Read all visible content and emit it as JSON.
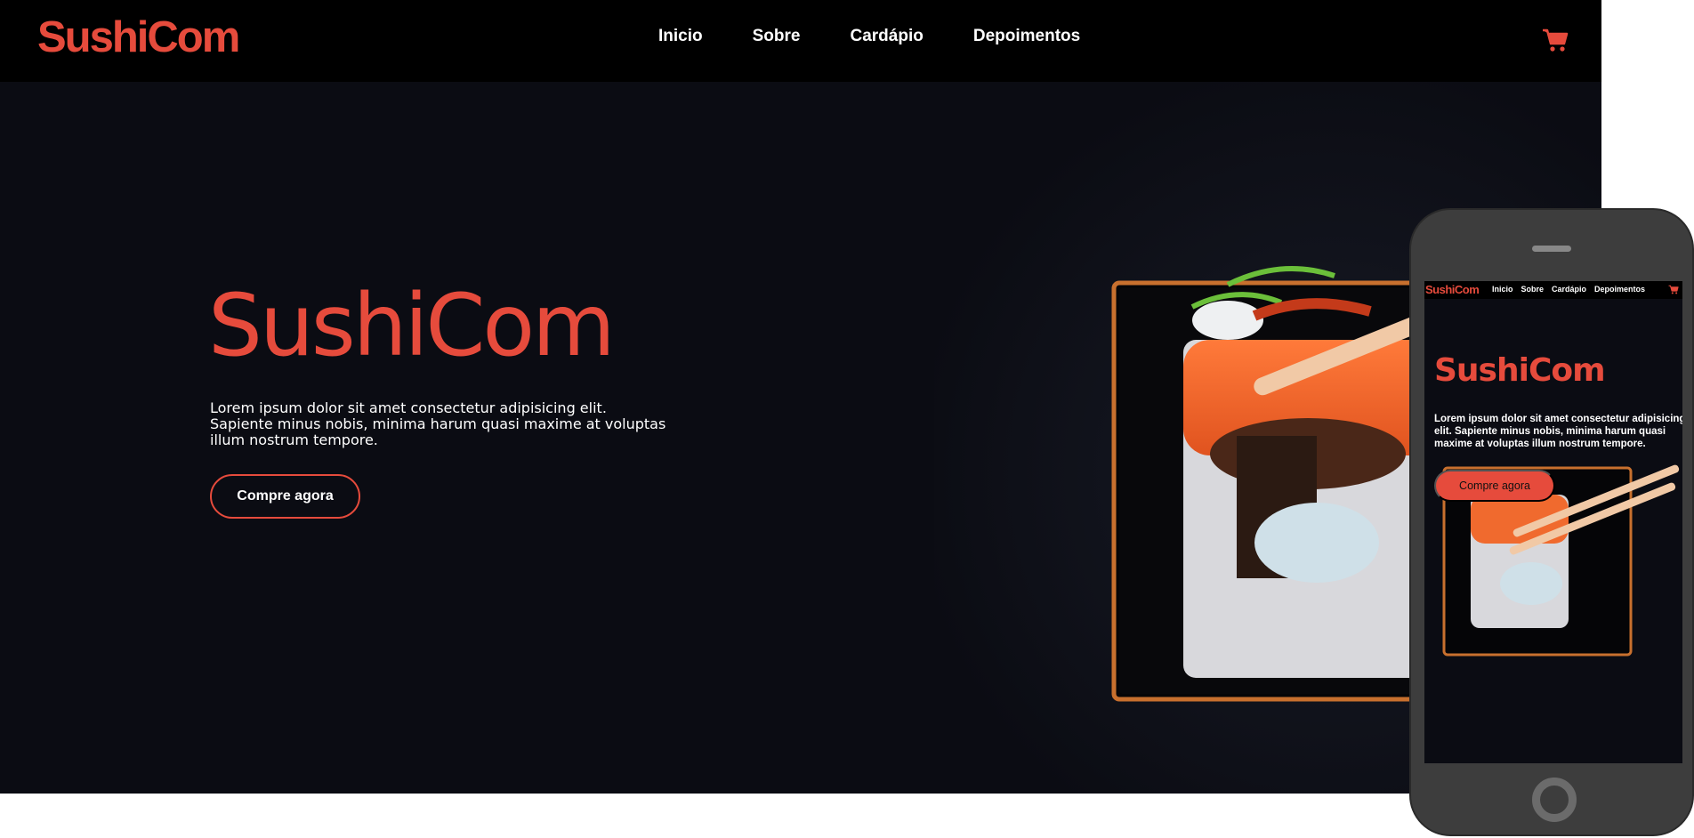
{
  "brand": {
    "logo_text": "SushiCom",
    "accent": "#e64b3c"
  },
  "nav": {
    "items": [
      {
        "label": "Inicio"
      },
      {
        "label": "Sobre"
      },
      {
        "label": "Cardápio"
      },
      {
        "label": "Depoimentos"
      }
    ]
  },
  "cart": {
    "icon": "cart-icon"
  },
  "hero": {
    "title": "SushiCom",
    "text": "Lorem ipsum dolor sit amet consectetur adipisicing elit. Sapiente minus nobis, minima harum quasi maxime at voluptas illum nostrum tempore.",
    "button_label": "Compre agora"
  },
  "mobile": {
    "logo_text": "SushiCom",
    "nav": [
      "Inicio",
      "Sobre",
      "Cardápio",
      "Depoimentos"
    ],
    "title": "SushiCom",
    "text": "Lorem ipsum dolor sit amet consectetur adipisicing elit. Sapiente minus nobis, minima harum quasi maxime at voluptas illum nostrum tempore.",
    "button_label": "Compre agora"
  }
}
